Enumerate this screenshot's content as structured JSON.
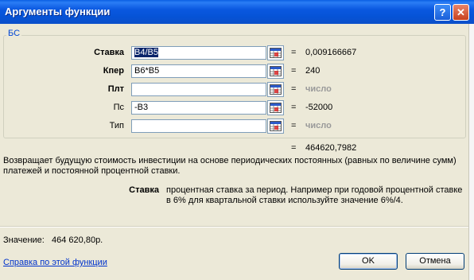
{
  "window": {
    "title": "Аргументы функции"
  },
  "titlebar": {
    "help_glyph": "?",
    "close_glyph": "✕"
  },
  "function_group": {
    "name": "БС"
  },
  "arguments": [
    {
      "label": "Ставка",
      "value": "B4/B5",
      "result": "0,009166667",
      "bold": true,
      "placeholder": false
    },
    {
      "label": "Кпер",
      "value": "B6*B5",
      "result": "240",
      "bold": true,
      "placeholder": false
    },
    {
      "label": "Плт",
      "value": "",
      "result": "число",
      "bold": true,
      "placeholder": true
    },
    {
      "label": "Пс",
      "value": "-B3",
      "result": "-52000",
      "bold": false,
      "placeholder": false
    },
    {
      "label": "Тип",
      "value": "",
      "result": "число",
      "bold": false,
      "placeholder": true
    }
  ],
  "equals_sign": "=",
  "formula_result": "464620,7982",
  "description": "Возвращает будущую стоимость инвестиции на основе периодических постоянных (равных по величине сумм) платежей и постоянной процентной ставки.",
  "param_help": {
    "name": "Ставка",
    "text": "процентная ставка за период. Например при годовой процентной ставке в 6% для квартальной ставки используйте значение 6%/4."
  },
  "result_line": {
    "label": "Значение:",
    "value": "464 620,80р."
  },
  "help_link": "Справка по этой функции",
  "buttons": {
    "ok": "OK",
    "cancel": "Отмена"
  },
  "colors": {
    "titlebar": "#0a5fe3",
    "dialog_bg": "#ece9d8",
    "link": "#0033cc",
    "group_legend": "#0046d5"
  }
}
